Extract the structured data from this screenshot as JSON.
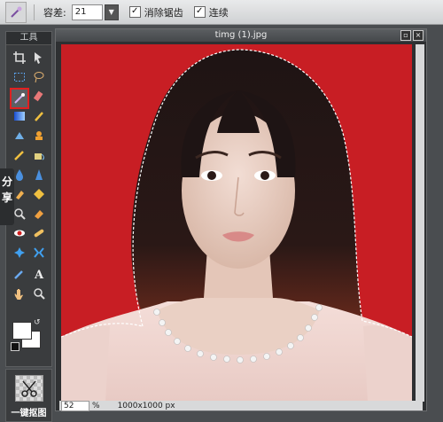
{
  "options_bar": {
    "tolerance_label": "容差:",
    "tolerance_value": "21",
    "antialias_label": "消除锯齿",
    "contiguous_label": "连续"
  },
  "toolbox": {
    "title": "工具"
  },
  "share_tab": {
    "label_1": "分",
    "label_2": "享"
  },
  "cutout": {
    "label": "一键抠图"
  },
  "document": {
    "title": "timg (1).jpg",
    "zoom": "52",
    "zoom_unit": "%",
    "dimensions": "1000x1000 px"
  },
  "colors": {
    "background_red": "#c81e24",
    "selected_tool_border": "#e02020"
  }
}
